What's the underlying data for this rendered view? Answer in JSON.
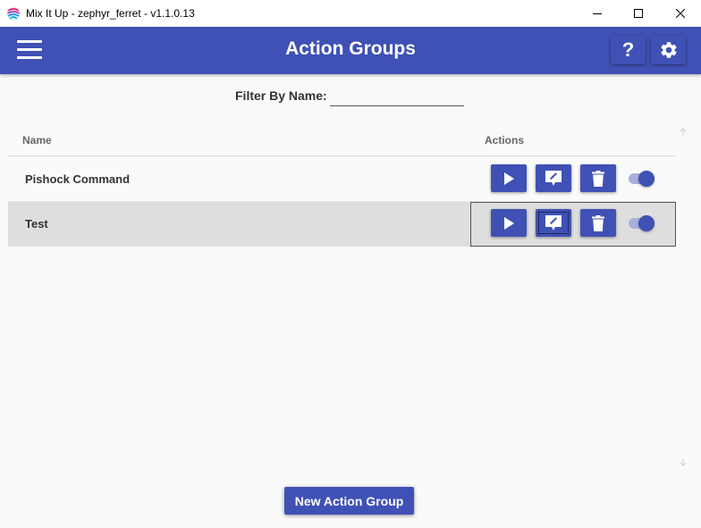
{
  "window": {
    "title": "Mix It Up - zephyr_ferret - v1.1.0.13",
    "controls": [
      "minimize-icon",
      "maximize-icon",
      "close-icon"
    ]
  },
  "header": {
    "title": "Action Groups",
    "help_label": "?",
    "accent_color": "#3f51b5"
  },
  "filter": {
    "label": "Filter By Name:",
    "value": "",
    "placeholder": ""
  },
  "table": {
    "columns": [
      "Name",
      "Actions"
    ],
    "rows": [
      {
        "name": "Pishock Command",
        "enabled": true,
        "actions": [
          "play-icon",
          "edit-icon",
          "delete-icon"
        ]
      },
      {
        "name": "Test",
        "enabled": true,
        "actions": [
          "play-icon",
          "edit-icon",
          "delete-icon"
        ],
        "selected": true
      }
    ]
  },
  "footer": {
    "new_button_label": "New Action Group"
  }
}
